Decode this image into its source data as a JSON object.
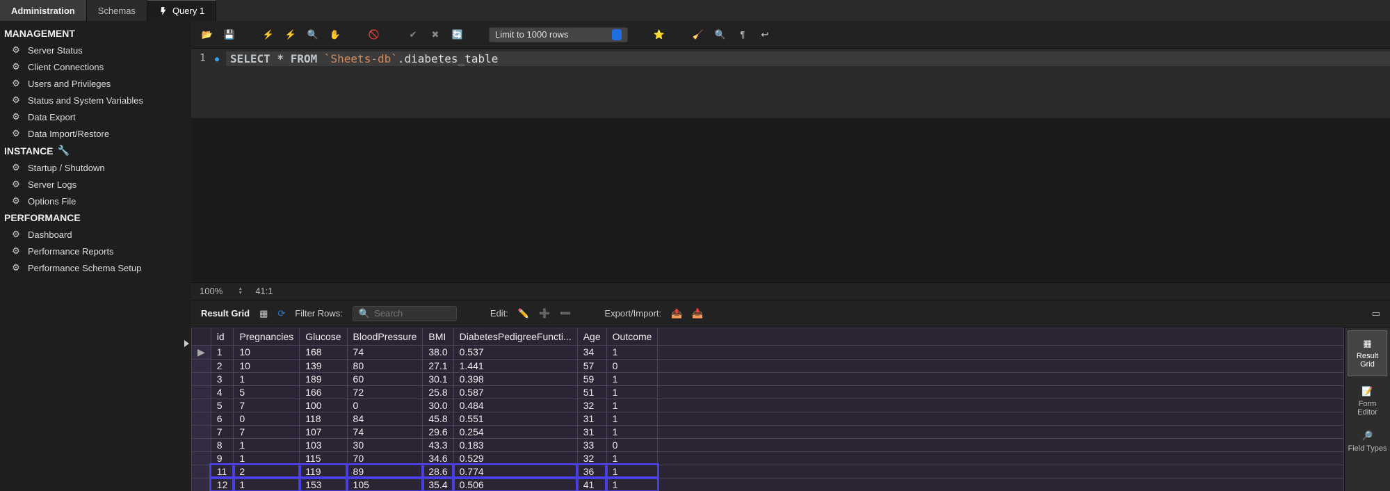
{
  "tabs": {
    "admin": "Administration",
    "schemas": "Schemas",
    "query": "Query 1"
  },
  "sidebar": {
    "section_management": "MANAGEMENT",
    "management_items": [
      "Server Status",
      "Client Connections",
      "Users and Privileges",
      "Status and System Variables",
      "Data Export",
      "Data Import/Restore"
    ],
    "section_instance": "INSTANCE",
    "instance_items": [
      "Startup / Shutdown",
      "Server Logs",
      "Options File"
    ],
    "section_performance": "PERFORMANCE",
    "performance_items": [
      "Dashboard",
      "Performance Reports",
      "Performance Schema Setup"
    ]
  },
  "toolbar": {
    "limit_label": "Limit to 1000 rows"
  },
  "editor": {
    "line_no": "1",
    "kw_select": "SELECT",
    "kw_star": "*",
    "kw_from": "FROM",
    "db_quoted": "`Sheets-db`",
    "rest": ".diabetes_table"
  },
  "status": {
    "zoom": "100%",
    "pos": "41:1"
  },
  "results_toolbar": {
    "label": "Result Grid",
    "filter_label": "Filter Rows:",
    "search_placeholder": "Search",
    "edit_label": "Edit:",
    "export_label": "Export/Import:"
  },
  "columns": [
    "id",
    "Pregnancies",
    "Glucose",
    "BloodPressure",
    "BMI",
    "DiabetesPedigreeFuncti...",
    "Age",
    "Outcome"
  ],
  "rows": [
    {
      "mark": "▶",
      "cells": [
        "1",
        "10",
        "168",
        "74",
        "38.0",
        "0.537",
        "34",
        "1"
      ],
      "hl": false
    },
    {
      "mark": "",
      "cells": [
        "2",
        "10",
        "139",
        "80",
        "27.1",
        "1.441",
        "57",
        "0"
      ],
      "hl": false
    },
    {
      "mark": "",
      "cells": [
        "3",
        "1",
        "189",
        "60",
        "30.1",
        "0.398",
        "59",
        "1"
      ],
      "hl": false
    },
    {
      "mark": "",
      "cells": [
        "4",
        "5",
        "166",
        "72",
        "25.8",
        "0.587",
        "51",
        "1"
      ],
      "hl": false
    },
    {
      "mark": "",
      "cells": [
        "5",
        "7",
        "100",
        "0",
        "30.0",
        "0.484",
        "32",
        "1"
      ],
      "hl": false
    },
    {
      "mark": "",
      "cells": [
        "6",
        "0",
        "118",
        "84",
        "45.8",
        "0.551",
        "31",
        "1"
      ],
      "hl": false
    },
    {
      "mark": "",
      "cells": [
        "7",
        "7",
        "107",
        "74",
        "29.6",
        "0.254",
        "31",
        "1"
      ],
      "hl": false
    },
    {
      "mark": "",
      "cells": [
        "8",
        "1",
        "103",
        "30",
        "43.3",
        "0.183",
        "33",
        "0"
      ],
      "hl": false
    },
    {
      "mark": "",
      "cells": [
        "9",
        "1",
        "115",
        "70",
        "34.6",
        "0.529",
        "32",
        "1"
      ],
      "hl": false
    },
    {
      "mark": "",
      "cells": [
        "11",
        "2",
        "119",
        "89",
        "28.6",
        "0.774",
        "36",
        "1"
      ],
      "hl": true
    },
    {
      "mark": "",
      "cells": [
        "12",
        "1",
        "153",
        "105",
        "35.4",
        "0.506",
        "41",
        "1"
      ],
      "hl": true
    }
  ],
  "right_tools": {
    "result_grid": "Result\nGrid",
    "form_editor": "Form\nEditor",
    "field_types": "Field\nTypes"
  }
}
